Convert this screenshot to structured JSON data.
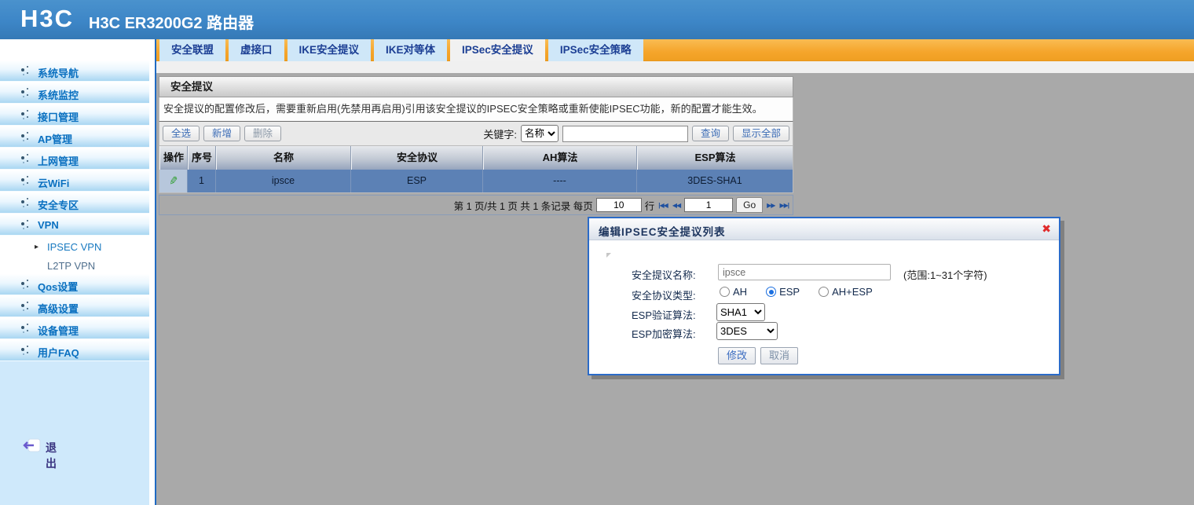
{
  "header": {
    "logo": "H3C",
    "title": "H3C ER3200G2 路由器"
  },
  "tabs": [
    {
      "label": "安全联盟",
      "active": false
    },
    {
      "label": "虚接口",
      "active": false
    },
    {
      "label": "IKE安全提议",
      "active": false
    },
    {
      "label": "IKE对等体",
      "active": false
    },
    {
      "label": "IPSec安全提议",
      "active": true
    },
    {
      "label": "IPSec安全策略",
      "active": false
    }
  ],
  "sidebar": {
    "items": [
      {
        "label": "系统导航"
      },
      {
        "label": "系统监控"
      },
      {
        "label": "接口管理"
      },
      {
        "label": "AP管理"
      },
      {
        "label": "上网管理"
      },
      {
        "label": "云WiFi"
      },
      {
        "label": "安全专区"
      },
      {
        "label": "VPN",
        "expanded": true
      },
      {
        "label": "Qos设置"
      },
      {
        "label": "高级设置"
      },
      {
        "label": "设备管理"
      },
      {
        "label": "用户FAQ"
      }
    ],
    "sub_items": [
      {
        "label": "IPSEC VPN",
        "active": true
      },
      {
        "label": "L2TP VPN",
        "active": false
      }
    ],
    "logout_label": "退出"
  },
  "panel": {
    "title": "安全提议",
    "notice": "安全提议的配置修改后，需要重新启用(先禁用再启用)引用该安全提议的IPSEC安全策略或重新使能IPSEC功能，新的配置才能生效。",
    "toolbar": {
      "select_all": "全选",
      "add": "新增",
      "delete": "删除",
      "keyword_label": "关键字:",
      "keyword_option": "名称",
      "keyword_value": "",
      "search": "查询",
      "show_all": "显示全部"
    },
    "table": {
      "headers": [
        "操作",
        "序号",
        "名称",
        "安全协议",
        "AH算法",
        "ESP算法"
      ],
      "rows": [
        {
          "seq": "1",
          "name": "ipsce",
          "protocol": "ESP",
          "ah": "----",
          "esp": "3DES-SHA1"
        }
      ]
    },
    "pagination": {
      "info": "第 1 页/共 1 页 共 1 条记录 每页",
      "per_page": "10",
      "rows_label": "行",
      "first_icon": "|◀◀",
      "prev_icon": "◀◀",
      "page": "1",
      "go_label": "Go",
      "next_icon": "▶▶",
      "last_icon": "▶▶|"
    }
  },
  "modal": {
    "title": "编辑IPSEC安全提议列表",
    "close_icon": "✖",
    "fields": {
      "name_label": "安全提议名称:",
      "name_value": "ipsce",
      "name_hint": "(范围:1~31个字符)",
      "type_label": "安全协议类型:",
      "type_options": [
        {
          "label": "AH",
          "checked": false
        },
        {
          "label": "ESP",
          "checked": true
        },
        {
          "label": "AH+ESP",
          "checked": false
        }
      ],
      "auth_label": "ESP验证算法:",
      "auth_value": "SHA1",
      "enc_label": "ESP加密算法:",
      "enc_value": "3DES"
    },
    "buttons": {
      "ok": "修改",
      "cancel": "取消"
    }
  },
  "icons": {
    "edit_icon": "✎",
    "sub_arrow_icon": "▸"
  },
  "colors": {
    "header_blue": "#3d86c7",
    "tab_orange": "#f5a52b",
    "tab_blue": "#cfe7f8",
    "content_gray": "#a9a9a9",
    "row_selected_blue": "#5c81b5",
    "sidebar_link_blue": "#0a70c0",
    "modal_border_blue": "#2b6bc8",
    "close_red": "#e02b2b",
    "button_link_blue": "#3c6cb5"
  }
}
